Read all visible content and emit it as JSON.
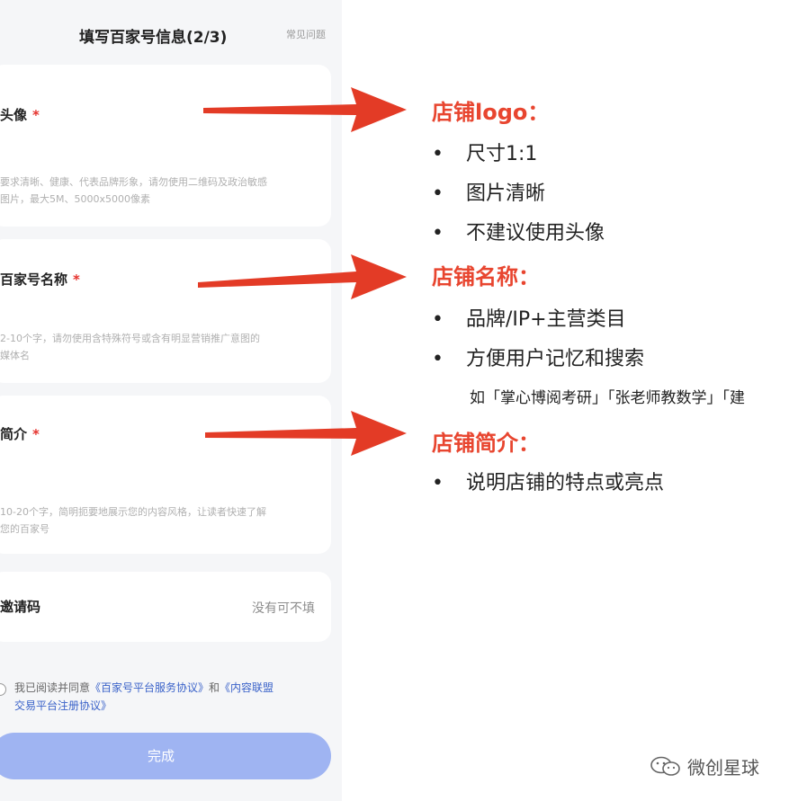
{
  "phone": {
    "header": {
      "title": "填写百家号信息(2/3)",
      "faq_link": "常见问题"
    },
    "avatar": {
      "label": "头像",
      "required_mark": "*",
      "hint_line1": "要求清晰、健康、代表品牌形象，请勿使用二维码及政治敏感",
      "hint_line2": "图片，最大5M、5000x5000像素"
    },
    "account_name": {
      "label": "百家号名称",
      "required_mark": "*",
      "hint_line1": "2-10个字，请勿使用含特殊符号或含有明显营销推广意图的",
      "hint_line2": "媒体名"
    },
    "intro": {
      "label": "简介",
      "required_mark": "*",
      "hint_line1": "10-20个字，简明扼要地展示您的内容风格，让读者快速了解",
      "hint_line2": "您的百家号"
    },
    "invite": {
      "label": "邀请码",
      "placeholder": "没有可不填"
    },
    "agreement": {
      "prefix": "我已阅读并同意",
      "link1": "《百家号平台服务协议》",
      "middle": "和",
      "link2_line1": "《内容联盟",
      "link2_line2": "交易平台注册协议》"
    },
    "finish_button": "完成"
  },
  "annotations": {
    "logo": {
      "title": "店铺logo：",
      "bullets": [
        "尺寸1:1",
        "图片清晰",
        "不建议使用头像"
      ]
    },
    "name": {
      "title": "店铺名称：",
      "bullets": [
        "品牌/IP+主营类目",
        "方便用户记忆和搜索"
      ],
      "example": "如「掌心博阅考研」「张老师教数学」「建"
    },
    "intro": {
      "title": "店铺简介：",
      "bullets": [
        "说明店铺的特点或亮点"
      ]
    },
    "bullet_symbol": "•"
  },
  "watermark": {
    "text": "微创星球",
    "icon": "wechat-icon"
  },
  "colors": {
    "accent": "#e8452f",
    "arrow": "#e33b26",
    "button": "#9fb4f2",
    "link": "#3a62c9",
    "required": "#e5322d"
  }
}
